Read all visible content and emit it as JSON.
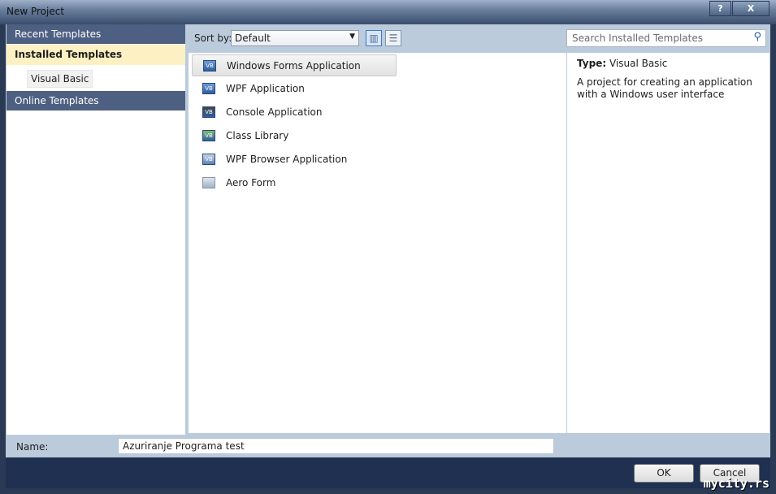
{
  "window": {
    "title": "New Project",
    "help": "?",
    "close": "X"
  },
  "sidebar": {
    "recent": "Recent Templates",
    "installed": "Installed Templates",
    "visual_basic": "Visual Basic",
    "online": "Online Templates"
  },
  "toolbar": {
    "sort_label": "Sort by:",
    "sort_value": "Default",
    "search_placeholder": "Search Installed Templates"
  },
  "templates": [
    {
      "name": "Windows Forms Application",
      "icon": "vb-forms-icon"
    },
    {
      "name": "WPF Application",
      "icon": "vb-wpf-icon"
    },
    {
      "name": "Console Application",
      "icon": "vb-console-icon"
    },
    {
      "name": "Class Library",
      "icon": "vb-library-icon"
    },
    {
      "name": "WPF Browser Application",
      "icon": "vb-wpf-browser-icon"
    },
    {
      "name": "Aero Form",
      "icon": "aero-form-icon"
    }
  ],
  "details": {
    "type_label": "Type:",
    "type_value": "Visual Basic",
    "description": "A project for creating an application with a Windows user interface"
  },
  "name": {
    "label": "Name:",
    "value": "Azuriranje Programa test"
  },
  "buttons": {
    "ok": "OK",
    "cancel": "Cancel"
  },
  "watermark": "mycity.rs"
}
